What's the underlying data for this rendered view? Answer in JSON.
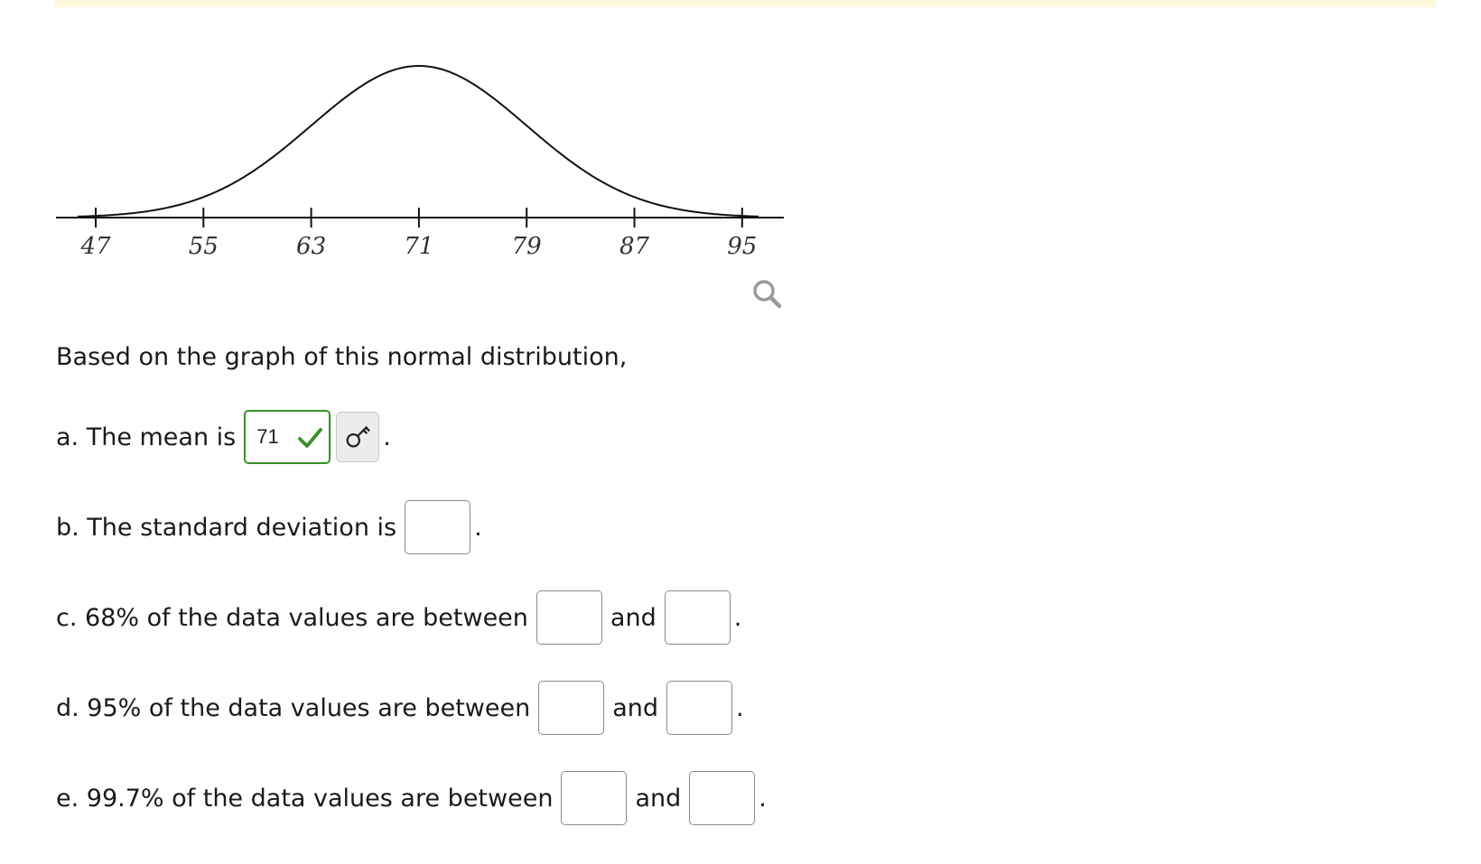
{
  "graph": {
    "x_ticks": [
      "47",
      "55",
      "63",
      "71",
      "79",
      "87",
      "95"
    ]
  },
  "icons": {
    "zoom": "magnifier-icon",
    "check": "checkmark-icon",
    "key": "key-icon"
  },
  "colors": {
    "banner": "#fdf7dc",
    "correct_border": "#3a8f2a",
    "check": "#3a8f2a"
  },
  "intro": "Based on the graph of this normal distribution,",
  "questions": {
    "a": {
      "prefix": "a. The mean is",
      "value": "71",
      "suffix": "."
    },
    "b": {
      "prefix": "b. The standard deviation is",
      "value": "",
      "suffix": "."
    },
    "c": {
      "prefix": "c. 68% of the data values are between",
      "and": "and",
      "value1": "",
      "value2": "",
      "suffix": "."
    },
    "d": {
      "prefix": "d. 95% of the data values are between",
      "and": "and",
      "value1": "",
      "value2": "",
      "suffix": "."
    },
    "e": {
      "prefix": "e. 99.7% of the data values are between",
      "and": "and",
      "value1": "",
      "value2": "",
      "suffix": "."
    }
  }
}
